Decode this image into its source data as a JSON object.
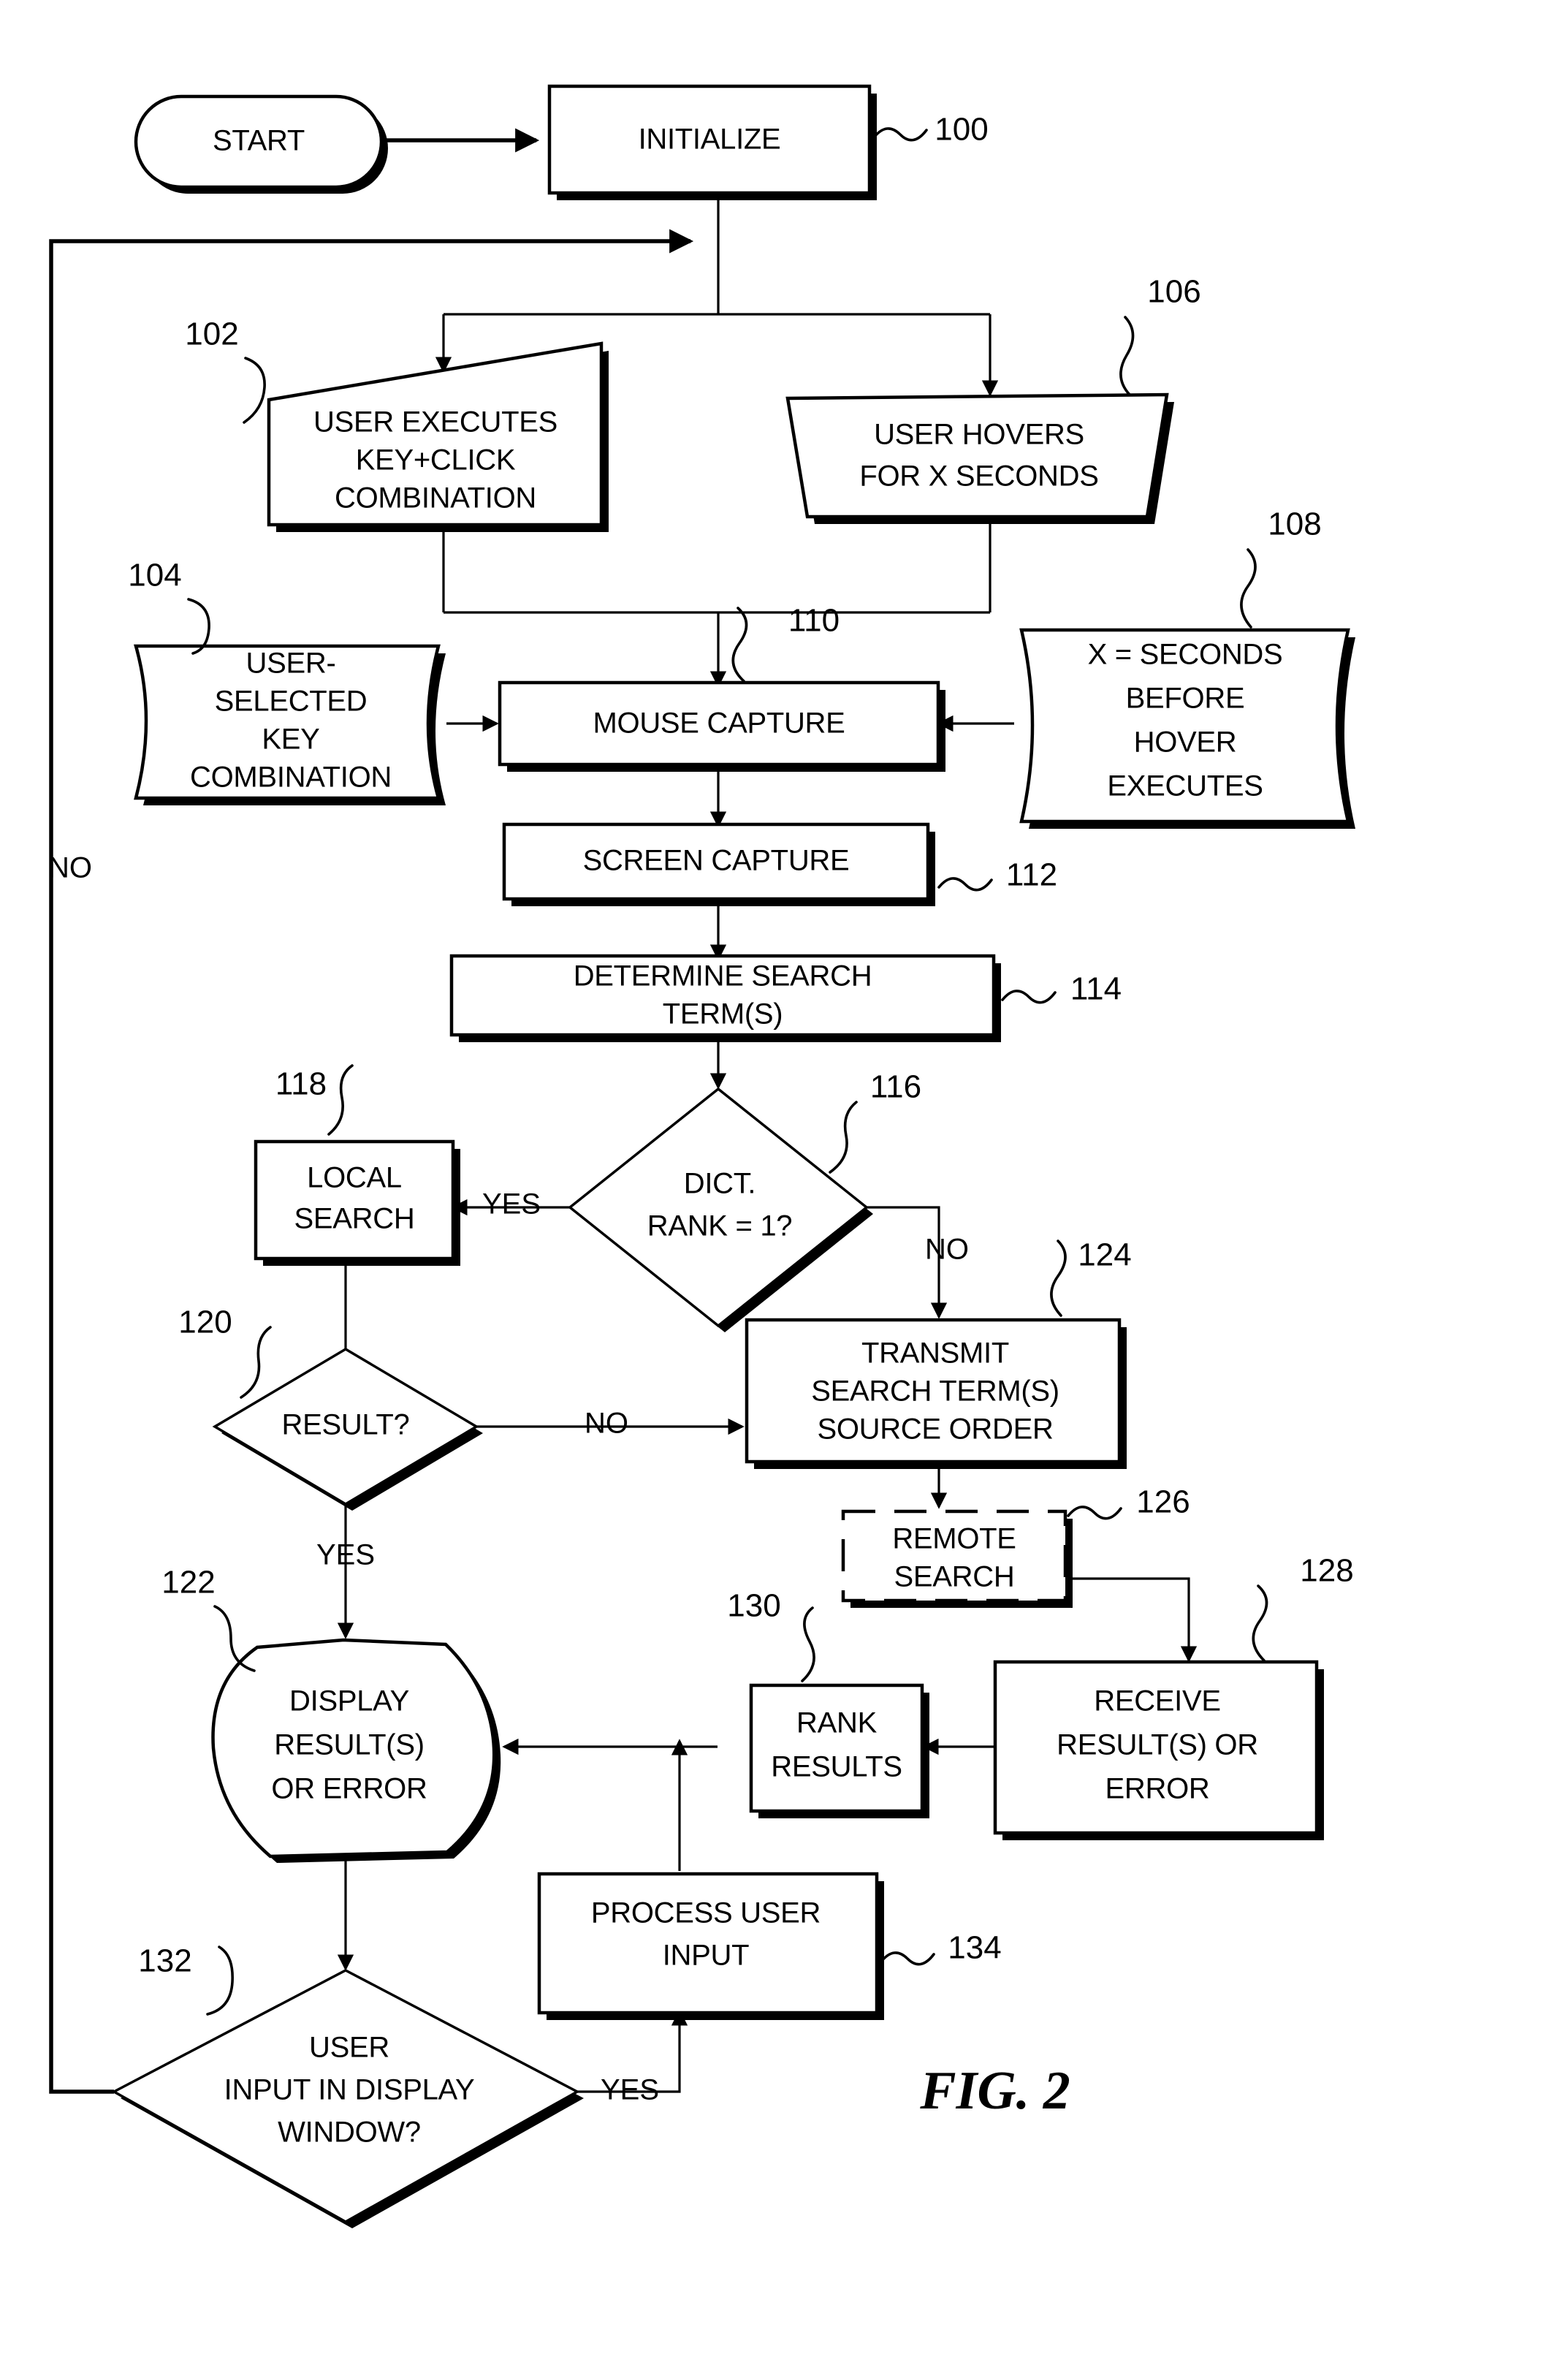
{
  "figure": {
    "label": "FIG. 2",
    "type": "patent-flowchart"
  },
  "nodes": {
    "start": {
      "ref": "",
      "lines": [
        "START"
      ],
      "shape": "terminator"
    },
    "initialize": {
      "ref": "100",
      "lines": [
        "INITIALIZE"
      ],
      "shape": "process"
    },
    "key_click": {
      "ref": "102",
      "lines": [
        "USER EXECUTES",
        "KEY+CLICK",
        "COMBINATION"
      ],
      "shape": "skewed-input"
    },
    "user_key": {
      "ref": "104",
      "lines": [
        "USER-",
        "SELECTED",
        "KEY",
        "COMBINATION"
      ],
      "shape": "tape"
    },
    "hover": {
      "ref": "106",
      "lines": [
        "USER HOVERS",
        "FOR X SECONDS"
      ],
      "shape": "trapezoid"
    },
    "x_seconds": {
      "ref": "108",
      "lines": [
        "X = SECONDS",
        "BEFORE",
        "HOVER",
        "EXECUTES"
      ],
      "shape": "tape"
    },
    "mouse_cap": {
      "ref": "110",
      "lines": [
        "MOUSE CAPTURE"
      ],
      "shape": "process"
    },
    "screen_cap": {
      "ref": "112",
      "lines": [
        "SCREEN CAPTURE"
      ],
      "shape": "process"
    },
    "determine": {
      "ref": "114",
      "lines": [
        "DETERMINE SEARCH",
        "TERM(S)"
      ],
      "shape": "process"
    },
    "dict_rank": {
      "ref": "116",
      "lines": [
        "DICT.",
        "RANK =  1?"
      ],
      "shape": "decision"
    },
    "local": {
      "ref": "118",
      "lines": [
        "LOCAL",
        "SEARCH"
      ],
      "shape": "process"
    },
    "result": {
      "ref": "120",
      "lines": [
        "RESULT?"
      ],
      "shape": "decision"
    },
    "display": {
      "ref": "122",
      "lines": [
        "DISPLAY",
        "RESULT(S)",
        "OR ERROR"
      ],
      "shape": "blob"
    },
    "transmit": {
      "ref": "124",
      "lines": [
        "TRANSMIT",
        "SEARCH TERM(S)",
        "SOURCE ORDER"
      ],
      "shape": "process"
    },
    "remote": {
      "ref": "126",
      "lines": [
        "REMOTE",
        "SEARCH"
      ],
      "shape": "process-dashed"
    },
    "receive": {
      "ref": "128",
      "lines": [
        "RECEIVE",
        "RESULT(S) OR",
        "ERROR"
      ],
      "shape": "process"
    },
    "rank": {
      "ref": "130",
      "lines": [
        "RANK",
        "RESULTS"
      ],
      "shape": "process"
    },
    "user_input": {
      "ref": "132",
      "lines": [
        "USER",
        "INPUT IN DISPLAY",
        "WINDOW?"
      ],
      "shape": "decision"
    },
    "process_in": {
      "ref": "134",
      "lines": [
        "PROCESS USER",
        "INPUT"
      ],
      "shape": "process"
    }
  },
  "edge_labels": {
    "no_loop": "NO",
    "dict_yes": "YES",
    "dict_no": "NO",
    "result_no": "NO",
    "result_yes": "YES",
    "user_input_yes": "YES"
  },
  "colors": {
    "stroke": "#000000",
    "fill": "#ffffff",
    "background": "#ffffff"
  }
}
